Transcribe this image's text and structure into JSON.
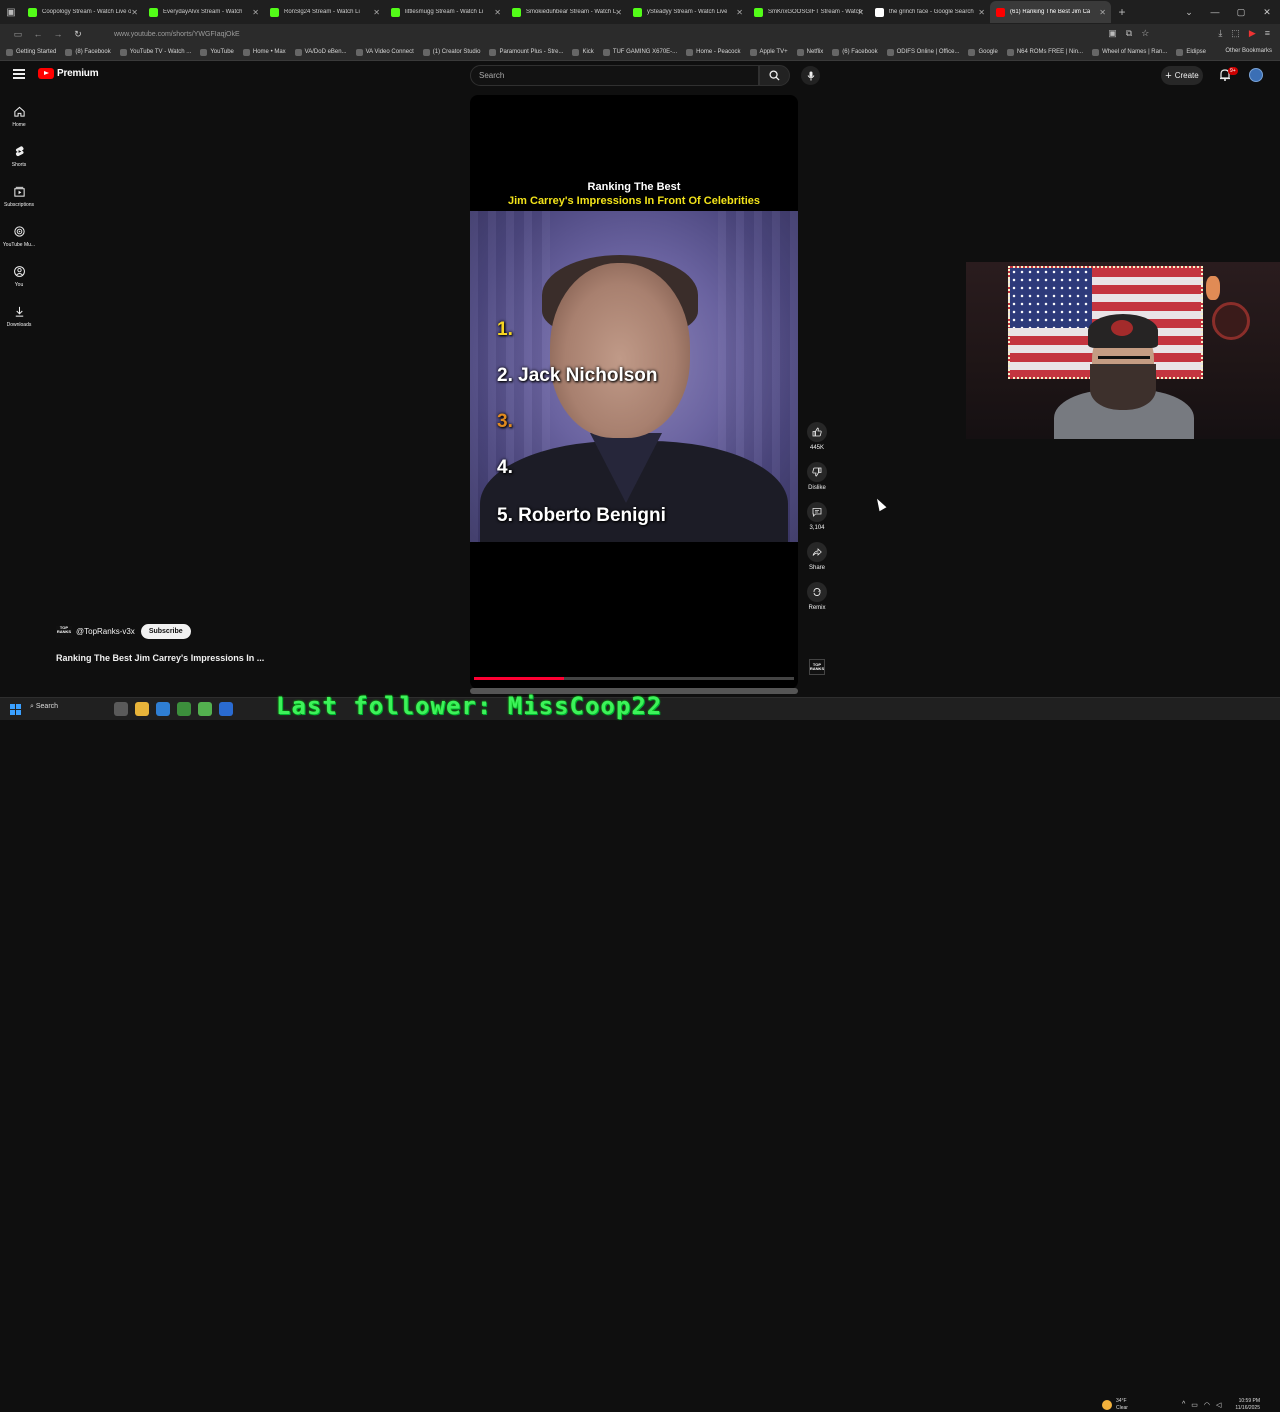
{
  "browser": {
    "tabs": [
      {
        "label": "Coopology Stream - Watch Live o",
        "color": "#53fc18"
      },
      {
        "label": "EverydayAlvx Stream - Watch",
        "color": "#53fc18"
      },
      {
        "label": "RonSlg24 Stream - Watch Li",
        "color": "#53fc18"
      },
      {
        "label": "littlesmugg Stream - Watch Li",
        "color": "#53fc18"
      },
      {
        "label": "Smokieduhbear Stream - Watch L",
        "color": "#53fc18"
      },
      {
        "label": "ySteadyy Stream - Watch Live",
        "color": "#53fc18"
      },
      {
        "label": "SmKnxGOOSGIFT Stream - Watch",
        "color": "#53fc18"
      },
      {
        "label": "the grinch face - Google Search",
        "color": "#ffffff"
      },
      {
        "label": "(61) Ranking The Best Jim Ca",
        "color": "#ff0000",
        "active": true
      }
    ],
    "url": "www.youtube.com/shorts/YWGFIaqjOkE",
    "bookmarks": [
      "Getting Started",
      "(8) Facebook",
      "YouTube TV - Watch ...",
      "YouTube",
      "Home • Max",
      "VA/DoD eBen...",
      "VA Video Connect",
      "(1) Creator Studio",
      "Paramount Plus - Stre...",
      "Kick",
      "TUF GAMING X670E-...",
      "Home - Peacock",
      "Apple TV+",
      "Netflix",
      "(6) Facebook",
      "ODIFS Online | Office...",
      "Google",
      "N64 ROMs FREE | Nin...",
      "Wheel of Names | Ran...",
      "Eldipse"
    ],
    "other_bookmarks": "Other Bookmarks"
  },
  "youtube": {
    "logo_text": "Premium",
    "search_placeholder": "Search",
    "create_label": "Create",
    "notif_badge": "9+",
    "sidenav": [
      {
        "label": "Home",
        "icon": "home-icon"
      },
      {
        "label": "Shorts",
        "icon": "shorts-icon"
      },
      {
        "label": "Subscriptions",
        "icon": "subscriptions-icon"
      },
      {
        "label": "YouTube Mu...",
        "icon": "youtube-music-icon"
      },
      {
        "label": "You",
        "icon": "you-icon"
      },
      {
        "label": "Downloads",
        "icon": "downloads-icon"
      }
    ]
  },
  "short": {
    "overlay_title_line1": "Ranking The Best",
    "overlay_title_line2": "Jim Carrey's Impressions In Front Of Celebrities",
    "ranks": [
      {
        "num": "1.",
        "name": ""
      },
      {
        "num": "2.",
        "name": "Jack Nicholson"
      },
      {
        "num": "3.",
        "name": ""
      },
      {
        "num": "4.",
        "name": ""
      },
      {
        "num": "5.",
        "name": "Roberto Benigni"
      }
    ],
    "progress": 0.28,
    "actions": {
      "like_count": "445K",
      "dislike_label": "Dislike",
      "comment_count": "3,104",
      "share_label": "Share",
      "remix_label": "Remix"
    },
    "channel_logo": "TOP RANKS",
    "channel_name": "@TopRanks-v3x",
    "subscribe_label": "Subscribe",
    "title": "Ranking The Best Jim Carrey's Impressions In ..."
  },
  "taskbar": {
    "search_label": "Search",
    "overlay_text": "Last follower: MissCoop22",
    "weather_temp": "34°F",
    "weather_desc": "Clear",
    "time": "10:59 PM",
    "date": "11/16/2025"
  }
}
